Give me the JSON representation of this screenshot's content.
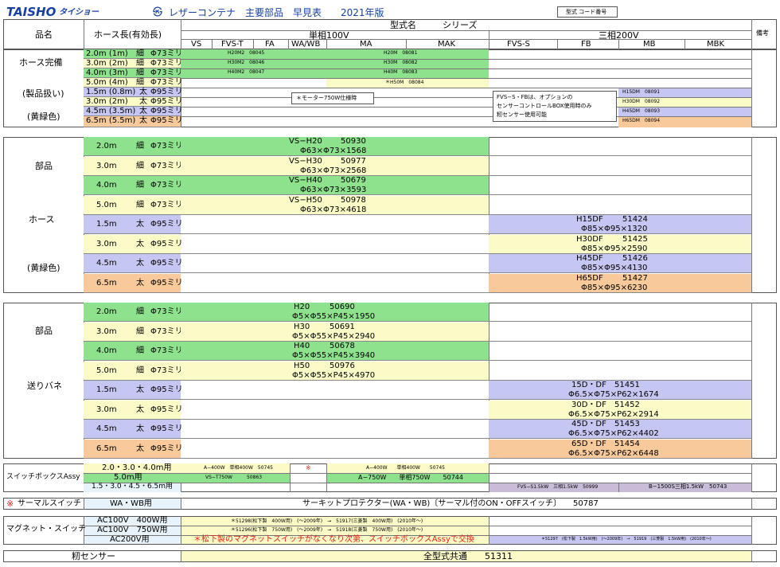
{
  "header": {
    "logo": "TAISHO",
    "logo_sub": "タイショー",
    "title": "レザーコンテナ　主要部品　早見表　　2021年版",
    "code_box": "型式 コード番号"
  },
  "columns": {
    "hinmei": "品名",
    "hose_len": "ホース長(有効長)",
    "model_series": "型式名　　　シリーズ",
    "single100": "単相100V",
    "three200": "三相200V",
    "biko": "備考",
    "models": [
      "VS",
      "FVS-T",
      "FA",
      "WA/WB",
      "MA",
      "MAK",
      "FVS-S",
      "FB",
      "MB",
      "MBK"
    ]
  },
  "sec1": {
    "name1": "ホース完備",
    "name2": "(製品扱い)",
    "name3": "(黄緑色)",
    "rows": [
      {
        "len": "2.0m (1m)",
        "size": "細",
        "dia": "Φ73ミリ"
      },
      {
        "len": "3.0m (2m)",
        "size": "細",
        "dia": "Φ73ミリ"
      },
      {
        "len": "4.0m (3m)",
        "size": "細",
        "dia": "Φ73ミリ"
      },
      {
        "len": "5.0m (4m)",
        "size": "細",
        "dia": "Φ73ミリ"
      },
      {
        "len": "1.5m (0.8m)",
        "size": "太",
        "dia": "Φ95ミリ"
      },
      {
        "len": "3.0m (2m)",
        "size": "太",
        "dia": "Φ95ミリ"
      },
      {
        "len": "4.5m (3.5m)",
        "size": "太",
        "dia": "Φ95ミリ"
      },
      {
        "len": "6.5m (5.5m)",
        "size": "太",
        "dia": "Φ95ミリ"
      }
    ],
    "codes_a": [
      {
        "m": "H20M2",
        "c": "08045"
      },
      {
        "m": "H30M2",
        "c": "08046"
      },
      {
        "m": "H40M2",
        "c": "08047"
      }
    ],
    "codes_b": [
      {
        "m": "H20M",
        "c": "08081"
      },
      {
        "m": "H30M",
        "c": "08082"
      },
      {
        "m": "H40M",
        "c": "08083"
      },
      {
        "m": "＊H50M",
        "c": "08084"
      }
    ],
    "codes_c": [
      {
        "m": "H15DM",
        "c": "08091"
      },
      {
        "m": "H30DM",
        "c": "08092"
      },
      {
        "m": "H45DM",
        "c": "08093"
      },
      {
        "m": "H65DM",
        "c": "08094"
      }
    ],
    "note_motor": "＊モーター750W仕様時",
    "note_fvs": [
      "FVS−S・FBは、オプションの",
      "センサーコントロールBOX使用時のみ",
      "籾センサー使用可能"
    ]
  },
  "sec2": {
    "name1": "部品",
    "name2": "ホース",
    "name3": "(黄緑色)",
    "rows": [
      {
        "len": "2.0m",
        "size": "細",
        "dia": "Φ73ミリ"
      },
      {
        "len": "3.0m",
        "size": "細",
        "dia": "Φ73ミリ"
      },
      {
        "len": "4.0m",
        "size": "細",
        "dia": "Φ73ミリ"
      },
      {
        "len": "5.0m",
        "size": "細",
        "dia": "Φ73ミリ"
      },
      {
        "len": "1.5m",
        "size": "太",
        "dia": "Φ95ミリ"
      },
      {
        "len": "3.0m",
        "size": "太",
        "dia": "Φ95ミリ"
      },
      {
        "len": "4.5m",
        "size": "太",
        "dia": "Φ95ミリ"
      },
      {
        "len": "6.5m",
        "size": "太",
        "dia": "Φ95ミリ"
      }
    ],
    "left": [
      {
        "m": "VS−H20",
        "c": "50930",
        "d": "Φ63×Φ73×1568"
      },
      {
        "m": "VS−H30",
        "c": "50977",
        "d": "Φ63×Φ73×2568"
      },
      {
        "m": "VS−H40",
        "c": "50679",
        "d": "Φ63×Φ73×3593"
      },
      {
        "m": "VS−H50",
        "c": "50978",
        "d": "Φ63×Φ73×4618"
      }
    ],
    "right": [
      {
        "m": "H15DF",
        "c": "51424",
        "d": "Φ85×Φ95×1320"
      },
      {
        "m": "H30DF",
        "c": "51425",
        "d": "Φ85×Φ95×2590"
      },
      {
        "m": "H45DF",
        "c": "51426",
        "d": "Φ85×Φ95×4130"
      },
      {
        "m": "H65DF",
        "c": "51427",
        "d": "Φ85×Φ95×6230"
      }
    ]
  },
  "sec3": {
    "name1": "部品",
    "name2": "送りバネ",
    "rows": [
      {
        "len": "2.0m",
        "size": "細",
        "dia": "Φ73ミリ"
      },
      {
        "len": "3.0m",
        "size": "細",
        "dia": "Φ73ミリ"
      },
      {
        "len": "4.0m",
        "size": "細",
        "dia": "Φ73ミリ"
      },
      {
        "len": "5.0m",
        "size": "細",
        "dia": "Φ73ミリ"
      },
      {
        "len": "1.5m",
        "size": "太",
        "dia": "Φ95ミリ"
      },
      {
        "len": "3.0m",
        "size": "太",
        "dia": "Φ95ミリ"
      },
      {
        "len": "4.5m",
        "size": "太",
        "dia": "Φ95ミリ"
      },
      {
        "len": "6.5m",
        "size": "太",
        "dia": "Φ95ミリ"
      }
    ],
    "left": [
      {
        "m": "H20",
        "c": "50690",
        "d": "Φ5×Φ55×P45×1950"
      },
      {
        "m": "H30",
        "c": "50691",
        "d": "Φ5×Φ55×P45×2940"
      },
      {
        "m": "H40",
        "c": "50678",
        "d": "Φ5×Φ55×P45×3940"
      },
      {
        "m": "H50",
        "c": "50976",
        "d": "Φ5×Φ55×P45×4970"
      }
    ],
    "right": [
      {
        "m": "15D・DF",
        "c": "51451",
        "d": "Φ6.5×Φ75×P62×1674"
      },
      {
        "m": "30D・DF",
        "c": "51452",
        "d": "Φ6.5×Φ75×P62×2914"
      },
      {
        "m": "45D・DF",
        "c": "51453",
        "d": "Φ6.5×Φ75×P62×4402"
      },
      {
        "m": "65D・DF",
        "c": "51454",
        "d": "Φ6.5×Φ75×P62×6448"
      }
    ]
  },
  "switchbox": {
    "name": "スイッチボックスAssy",
    "r1_label": "2.0・3.0・4.0m用",
    "r1_a": "A−400W　単相400W　50745",
    "r1_mark": "※",
    "r1_b": "A−400W　　単相400W　　50745",
    "r2_label": "5.0m用",
    "r2_a": "VS−T750W　　　50863",
    "r2_b": "A−750W　　単相750W　　50744",
    "r3_label": "1.5・3.0・4.5・6.5m用",
    "r3_a": "FVS−S1.5kW　三相1.5kW　50999",
    "r3_b": "B−1500S三相1.5kW　50743"
  },
  "thermal": {
    "mark": "※",
    "name": "サーマルスイッチ",
    "for": "WA・WB用",
    "desc": "サーキットプロテクター(WA・WB)〔サーマル付のON・OFFスイッチ〕　　50787"
  },
  "magnet": {
    "name": "マグネット・スイッチ",
    "r1_label": "AC100V　400W用",
    "r1_text": "＊51298(松下製　400W用)　(〜2009年)　→　51917(三菱製　400W用)　(2010年〜)",
    "r2_label": "AC100V　750W用",
    "r2_text": "＊51296(松下製　750W用)　(〜2009年)　→　51918(三菱製　750W用)　(2010年〜)",
    "r3_label": "AC200V用",
    "r3_text": "＊松下製のマグネットスイッチがなくなり次第、スイッチボックスAssyで交換",
    "r3_right": "＊51297　(松下製　1.5kW用)　(〜2009年)　→　51919　(三菱製　1.5kW用)　(2010年〜)"
  },
  "sensor": {
    "name": "籾センサー",
    "desc": "全型式共通　　51311"
  },
  "colors": {
    "green": "#8ee28e",
    "yellow": "#fbfbc8",
    "orange": "#f8c99a",
    "purple": "#c6c6f2",
    "red": "#e0201a",
    "logo": "#1840a0"
  }
}
